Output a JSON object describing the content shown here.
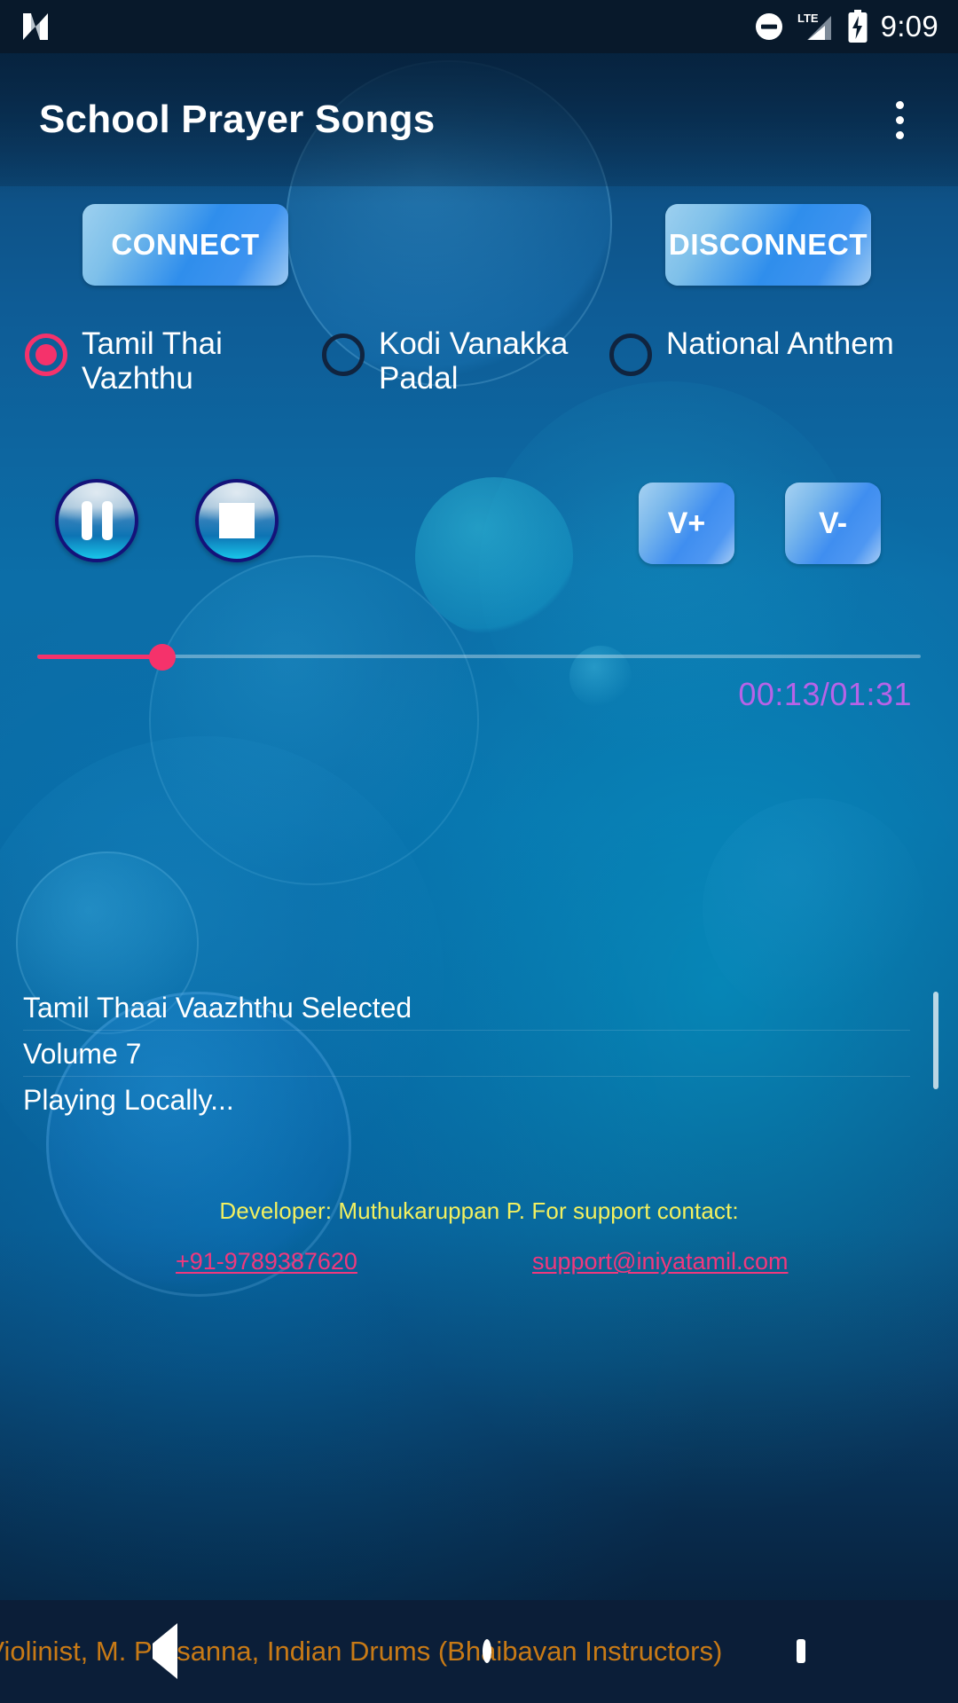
{
  "status_bar": {
    "notification_icon": "app-notification-icon",
    "dnd_icon": "do-not-disturb-icon",
    "network_label": "LTE",
    "signal_icon": "cell-signal-icon",
    "battery_icon": "battery-charging-icon",
    "clock": "9:09"
  },
  "app_bar": {
    "title": "School Prayer Songs",
    "overflow_icon": "more-vert-icon"
  },
  "connection": {
    "connect_label": "CONNECT",
    "disconnect_label": "DISCONNECT"
  },
  "songs": {
    "options": [
      {
        "label": "Tamil Thai Vazhthu",
        "selected": true
      },
      {
        "label": "Kodi Vanakka Padal",
        "selected": false
      },
      {
        "label": "National Anthem",
        "selected": false
      }
    ]
  },
  "media": {
    "pause_icon": "pause-icon",
    "stop_icon": "stop-icon",
    "volume_up_label": "V+",
    "volume_down_label": "V-"
  },
  "seek": {
    "elapsed": "00:13",
    "duration": "01:31",
    "time_label": "00:13/01:31",
    "progress_percent": 14,
    "accent_color": "#f5326b",
    "time_color": "#b763e8"
  },
  "log": {
    "lines": [
      "Tamil Thaai Vaazhthu Selected",
      "Volume 7",
      "Playing Locally..."
    ]
  },
  "footer": {
    "developer_line": "Developer: Muthukaruppan P. For support contact:",
    "phone": "+91-9789387620",
    "email": "support@iniyatamil.com",
    "developer_color": "#f2f060",
    "link_color": "#f0387e"
  },
  "marquee": {
    "text": "alam, Violinist, M. Prasanna, Indian Drums (Bhaibavan Instructors)",
    "color": "#c87a16"
  },
  "navigation": {
    "back_icon": "nav-back-icon",
    "home_icon": "nav-home-icon",
    "recents_icon": "nav-recents-icon"
  }
}
